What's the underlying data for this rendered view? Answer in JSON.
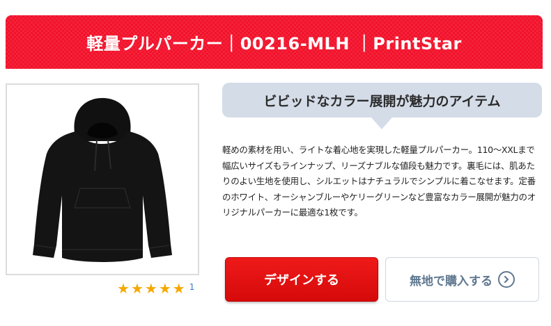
{
  "header": {
    "title": "軽量プルパーカー｜00216-MLH ｜PrintStar"
  },
  "product": {
    "image_icon": "hoodie-image",
    "rating_stars": 5,
    "rating_count": "1"
  },
  "catch_copy": "ビビッドなカラー展開が魅力のアイテム",
  "description": "軽めの素材を用い、ライトな着心地を実現した軽量プルパーカー。110〜XXLまで幅広いサイズもラインナップ、リーズナブルな値段も魅力です。裏毛には、肌あたりのよい生地を使用し、シルエットはナチュラルでシンプルに着こなせます。定番のホワイト、オーシャンブルーやケリーグリーンなど豊富なカラー展開が魅力のオリジナルパーカーに最適な1枚です。",
  "actions": {
    "design_label": "デザインする",
    "buy_label": "無地で購入する",
    "buy_icon": "chevron-right-circle-icon"
  },
  "colors": {
    "header_red": "#f2122b",
    "button_red": "#e01010",
    "catch_bg": "#d4dce8",
    "star": "#f5a800",
    "link_blue": "#3a78c5",
    "buy_text": "#5f7890"
  }
}
